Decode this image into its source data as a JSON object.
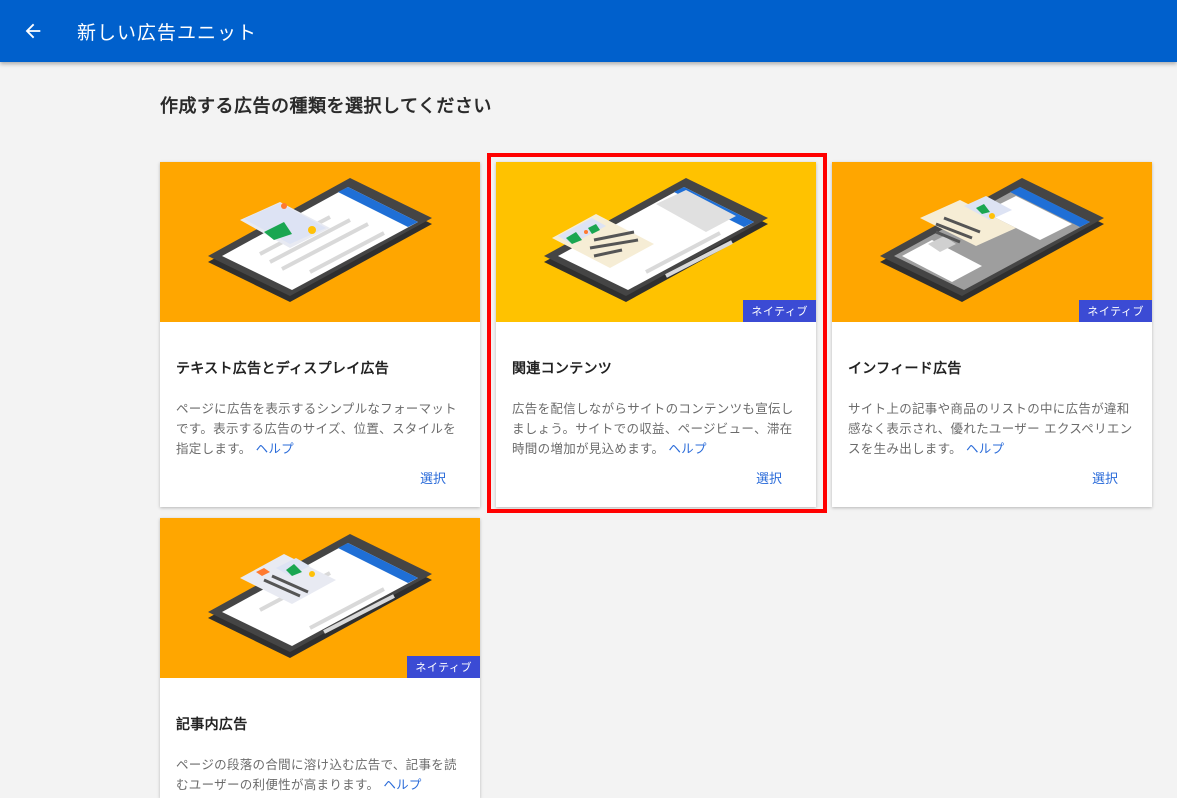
{
  "header": {
    "title": "新しい広告ユニット",
    "back_icon": "arrow-left-icon"
  },
  "page": {
    "heading": "作成する広告の種類を選択してください"
  },
  "colors": {
    "header_bg": "#0060cc",
    "card_image_bg": "#ffa600",
    "card_image_bg_selected": "#ffc200",
    "badge_bg": "#3b4bd4",
    "link": "#2a6bd9",
    "highlight": "#ff0000"
  },
  "cards": [
    {
      "title": "テキスト広告とディスプレイ広告",
      "description": "ページに広告を表示するシンプルなフォーマットです。表示する広告のサイズ、位置、スタイルを指定します。",
      "help": "ヘルプ",
      "action": "選択",
      "badge": "",
      "selected": false
    },
    {
      "title": "関連コンテンツ",
      "description": "広告を配信しながらサイトのコンテンツも宣伝しましょう。サイトでの収益、ページビュー、滞在時間の増加が見込めます。",
      "help": "ヘルプ",
      "action": "選択",
      "badge": "ネイティブ",
      "selected": true
    },
    {
      "title": "インフィード広告",
      "description": "サイト上の記事や商品のリストの中に広告が違和感なく表示され、優れたユーザー エクスペリエンスを生み出します。",
      "help": "ヘルプ",
      "action": "選択",
      "badge": "ネイティブ",
      "selected": false
    },
    {
      "title": "記事内広告",
      "description": "ページの段落の合間に溶け込む広告で、記事を読むユーザーの利便性が高まります。",
      "help": "ヘルプ",
      "action": "",
      "badge": "ネイティブ",
      "selected": false
    }
  ]
}
